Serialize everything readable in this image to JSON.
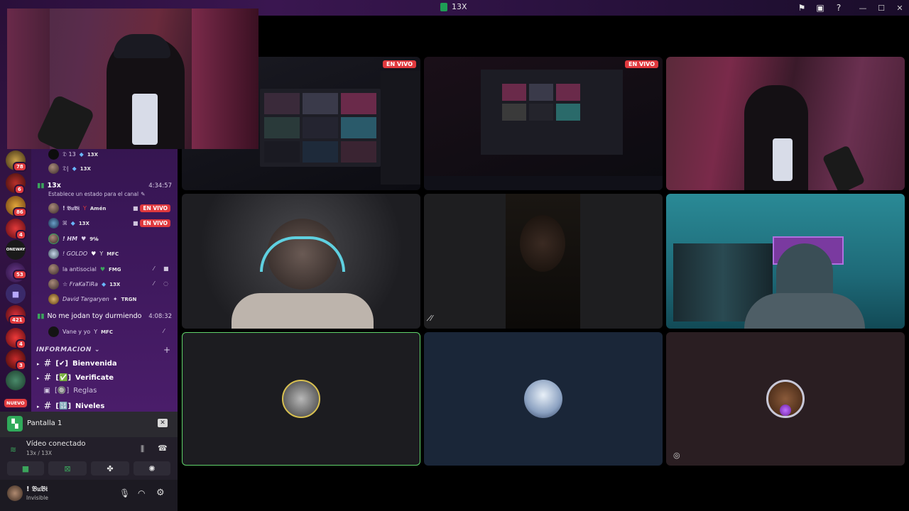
{
  "window": {
    "title": "13X",
    "toolbar_icons": [
      "flag-icon",
      "inbox-icon",
      "help-icon"
    ],
    "controls": [
      "minimize-icon",
      "maximize-icon",
      "close-icon"
    ]
  },
  "server_rail": {
    "badges": [
      "78",
      "6",
      "86",
      "4",
      "53",
      "421",
      "4",
      "3",
      "NUEVO"
    ],
    "labels": [
      "ONEWAY"
    ]
  },
  "channel": {
    "pre_rows": [
      {
        "name": "𝔇 13",
        "tag": "13X"
      },
      {
        "name": "𝔇|",
        "tag": "13X"
      }
    ],
    "voice_channel": {
      "name": "13x",
      "time": "4:34:57",
      "status_hint": "Establece un estado para el canal",
      "members": [
        {
          "name": "! 𝔅𝔲𝔅𝔦",
          "tag": "Amén",
          "live": "EN VIVO"
        },
        {
          "name": "ꕤ",
          "tag": "13X",
          "live": "EN VIVO"
        },
        {
          "name": "! HM",
          "tag": "9℅"
        },
        {
          "name": "! GOLDO",
          "tag": "MFC"
        },
        {
          "name": "la antisocial",
          "tag": "FMG"
        },
        {
          "name": "☆ FraKaTiRa",
          "tag": "13X"
        },
        {
          "name": "David Targaryen",
          "tag": "TRGN"
        }
      ]
    },
    "voice_channel_2": {
      "name": "No me jodan toy durmiendo",
      "time": "4:08:32",
      "members": [
        {
          "name": "Vane y yo",
          "tag": "MFC"
        }
      ]
    },
    "category": "INFORMACION",
    "text_channels": [
      {
        "prefix": "#",
        "emoji": "✔",
        "name": "Bienvenida"
      },
      {
        "prefix": "#",
        "emoji": "✅",
        "name": "Verificate"
      },
      {
        "prefix": "▣",
        "emoji": "🔘",
        "name": "Reglas"
      },
      {
        "prefix": "#",
        "emoji": "🔢",
        "name": "Niveles"
      }
    ]
  },
  "screen_share": {
    "label": "Pantalla 1"
  },
  "voice_status": {
    "title": "Vídeo conectado",
    "subtitle": "13x / 13X"
  },
  "user": {
    "name": "! 𝔅𝔲𝔅𝔦",
    "status": "Invisible"
  },
  "tiles": {
    "stream1_live": "EN VIVO",
    "stream2_live": "EN VIVO"
  },
  "colors": {
    "live": "#e0393e",
    "accent_green": "#3ba55c",
    "speaking_border": "#5fd36a"
  }
}
